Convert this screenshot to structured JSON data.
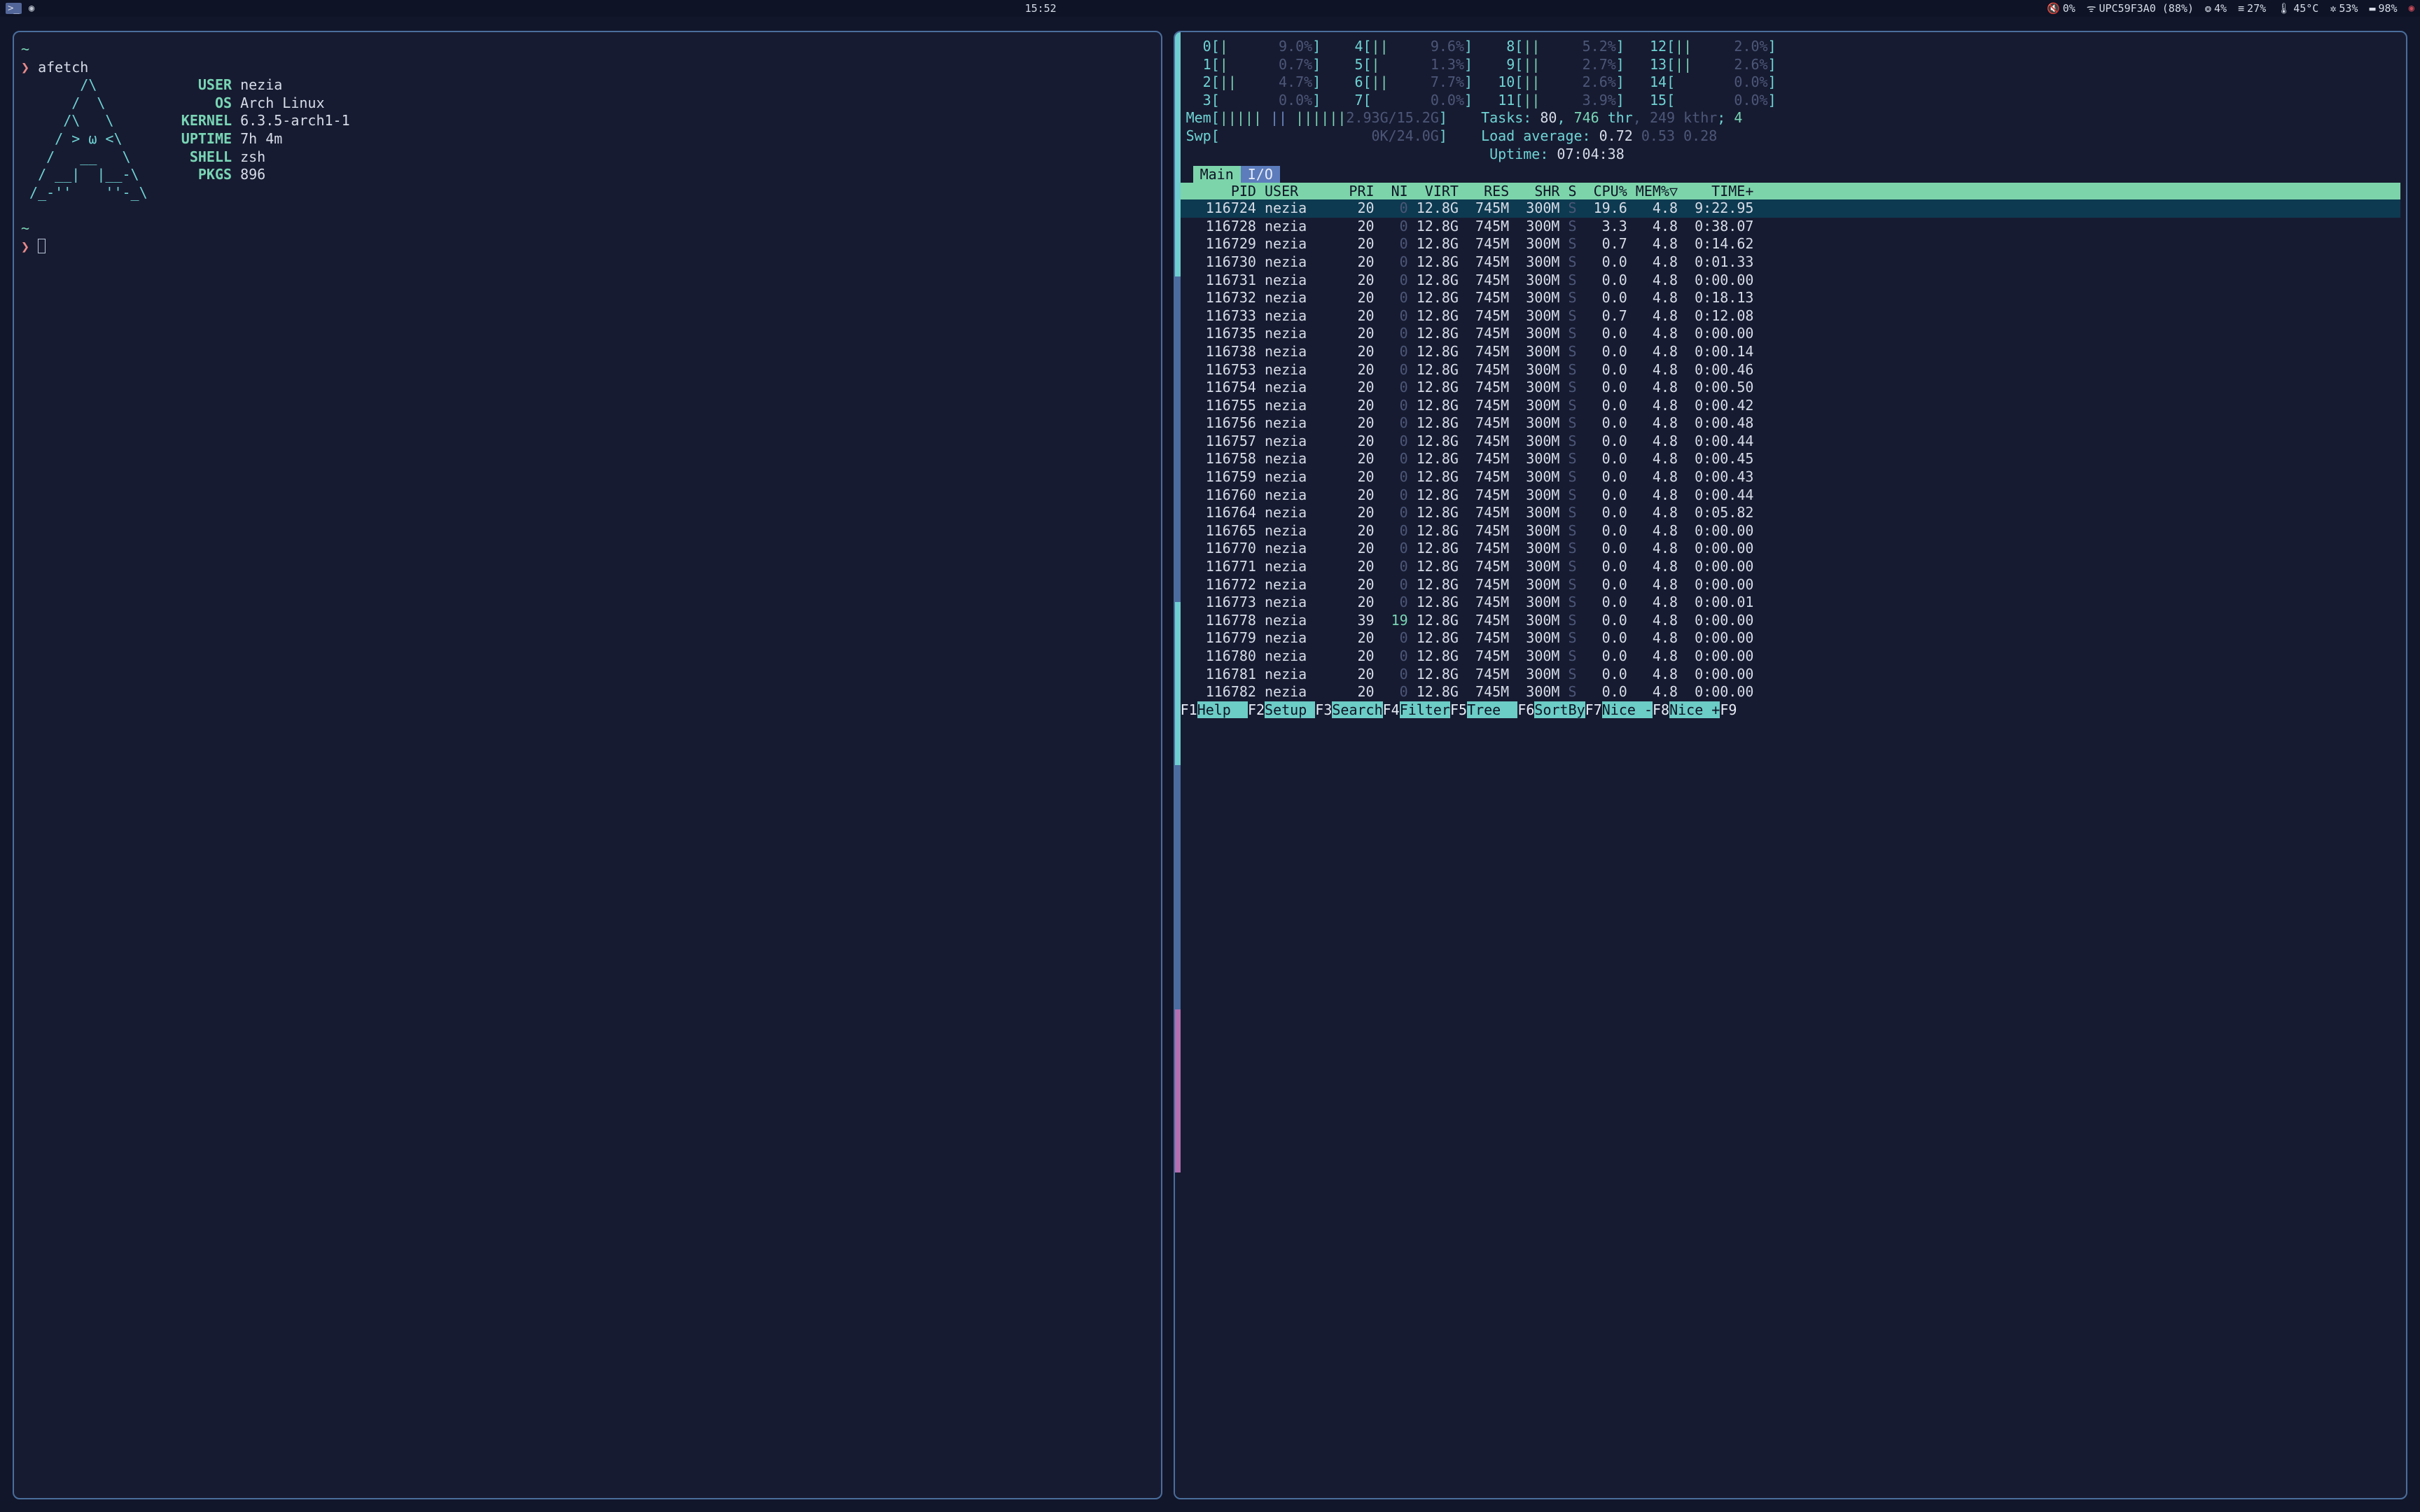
{
  "taskbar": {
    "clock": "15:52",
    "vol_pct": "0%",
    "wifi": "UPC59F3A0 (88%)",
    "gpu_pct": "4%",
    "ram_pct": "27%",
    "temp": "45°C",
    "brightness_pct": "53%",
    "battery_pct": "98%"
  },
  "afetch": {
    "cmd": "afetch",
    "ascii": [
      "       /\\",
      "      /  \\",
      "     /\\   \\",
      "    / > ω <\\",
      "   /   __   \\",
      "  / __|  |__-\\",
      " /_-''    ''-_\\"
    ],
    "rows": [
      {
        "k": "USER",
        "v": "nezia"
      },
      {
        "k": "OS",
        "v": "Arch Linux"
      },
      {
        "k": "KERNEL",
        "v": "6.3.5-arch1-1"
      },
      {
        "k": "UPTIME",
        "v": "7h 4m"
      },
      {
        "k": "SHELL",
        "v": "zsh"
      },
      {
        "k": "PKGS",
        "v": "896"
      }
    ]
  },
  "htop": {
    "cpu": [
      {
        "n": "0",
        "bar": "|",
        "pct": "9.0%"
      },
      {
        "n": "1",
        "bar": "|",
        "pct": "0.7%"
      },
      {
        "n": "2",
        "bar": "||",
        "pct": "4.7%"
      },
      {
        "n": "3",
        "bar": "",
        "pct": "0.0%"
      },
      {
        "n": "4",
        "bar": "||",
        "pct": "9.6%"
      },
      {
        "n": "5",
        "bar": "|",
        "pct": "1.3%"
      },
      {
        "n": "6",
        "bar": "||",
        "pct": "7.7%"
      },
      {
        "n": "7",
        "bar": "",
        "pct": "0.0%"
      },
      {
        "n": "8",
        "bar": "||",
        "pct": "5.2%"
      },
      {
        "n": "9",
        "bar": "||",
        "pct": "2.7%"
      },
      {
        "n": "10",
        "bar": "||",
        "pct": "2.6%"
      },
      {
        "n": "11",
        "bar": "||",
        "pct": "3.9%"
      },
      {
        "n": "12",
        "bar": "||",
        "pct": "2.0%"
      },
      {
        "n": "13",
        "bar": "||",
        "pct": "2.6%"
      },
      {
        "n": "14",
        "bar": "",
        "pct": "0.0%"
      },
      {
        "n": "15",
        "bar": "",
        "pct": "0.0%"
      }
    ],
    "mem": {
      "used": "2.93G",
      "total": "15.2G"
    },
    "swp": {
      "used": "0K",
      "total": "24.0G"
    },
    "tasks": {
      "count": "80",
      "thr": "746",
      "kthr": "249",
      "running": "4"
    },
    "load": [
      "0.72",
      "0.53",
      "0.28"
    ],
    "uptime": "07:04:38",
    "tabs": {
      "main": "Main",
      "io": "I/O"
    },
    "cols": {
      "pid": "PID",
      "user": "USER",
      "pri": "PRI",
      "ni": "NI",
      "virt": "VIRT",
      "res": "RES",
      "shr": "SHR",
      "s": "S",
      "cpu": "CPU%",
      "mem": "MEM%▽",
      "time": "TIME+"
    },
    "procs": [
      {
        "pid": "116724",
        "user": "nezia",
        "pri": "20",
        "ni": "0",
        "virt": "12.8G",
        "res": "745M",
        "shr": "300M",
        "s": "S",
        "cpu": "19.6",
        "mem": "4.8",
        "time": "9:22.95",
        "sel": true
      },
      {
        "pid": "116728",
        "user": "nezia",
        "pri": "20",
        "ni": "0",
        "virt": "12.8G",
        "res": "745M",
        "shr": "300M",
        "s": "S",
        "cpu": "3.3",
        "mem": "4.8",
        "time": "0:38.07"
      },
      {
        "pid": "116729",
        "user": "nezia",
        "pri": "20",
        "ni": "0",
        "virt": "12.8G",
        "res": "745M",
        "shr": "300M",
        "s": "S",
        "cpu": "0.7",
        "mem": "4.8",
        "time": "0:14.62"
      },
      {
        "pid": "116730",
        "user": "nezia",
        "pri": "20",
        "ni": "0",
        "virt": "12.8G",
        "res": "745M",
        "shr": "300M",
        "s": "S",
        "cpu": "0.0",
        "mem": "4.8",
        "time": "0:01.33"
      },
      {
        "pid": "116731",
        "user": "nezia",
        "pri": "20",
        "ni": "0",
        "virt": "12.8G",
        "res": "745M",
        "shr": "300M",
        "s": "S",
        "cpu": "0.0",
        "mem": "4.8",
        "time": "0:00.00"
      },
      {
        "pid": "116732",
        "user": "nezia",
        "pri": "20",
        "ni": "0",
        "virt": "12.8G",
        "res": "745M",
        "shr": "300M",
        "s": "S",
        "cpu": "0.0",
        "mem": "4.8",
        "time": "0:18.13"
      },
      {
        "pid": "116733",
        "user": "nezia",
        "pri": "20",
        "ni": "0",
        "virt": "12.8G",
        "res": "745M",
        "shr": "300M",
        "s": "S",
        "cpu": "0.7",
        "mem": "4.8",
        "time": "0:12.08"
      },
      {
        "pid": "116735",
        "user": "nezia",
        "pri": "20",
        "ni": "0",
        "virt": "12.8G",
        "res": "745M",
        "shr": "300M",
        "s": "S",
        "cpu": "0.0",
        "mem": "4.8",
        "time": "0:00.00"
      },
      {
        "pid": "116738",
        "user": "nezia",
        "pri": "20",
        "ni": "0",
        "virt": "12.8G",
        "res": "745M",
        "shr": "300M",
        "s": "S",
        "cpu": "0.0",
        "mem": "4.8",
        "time": "0:00.14"
      },
      {
        "pid": "116753",
        "user": "nezia",
        "pri": "20",
        "ni": "0",
        "virt": "12.8G",
        "res": "745M",
        "shr": "300M",
        "s": "S",
        "cpu": "0.0",
        "mem": "4.8",
        "time": "0:00.46"
      },
      {
        "pid": "116754",
        "user": "nezia",
        "pri": "20",
        "ni": "0",
        "virt": "12.8G",
        "res": "745M",
        "shr": "300M",
        "s": "S",
        "cpu": "0.0",
        "mem": "4.8",
        "time": "0:00.50"
      },
      {
        "pid": "116755",
        "user": "nezia",
        "pri": "20",
        "ni": "0",
        "virt": "12.8G",
        "res": "745M",
        "shr": "300M",
        "s": "S",
        "cpu": "0.0",
        "mem": "4.8",
        "time": "0:00.42"
      },
      {
        "pid": "116756",
        "user": "nezia",
        "pri": "20",
        "ni": "0",
        "virt": "12.8G",
        "res": "745M",
        "shr": "300M",
        "s": "S",
        "cpu": "0.0",
        "mem": "4.8",
        "time": "0:00.48"
      },
      {
        "pid": "116757",
        "user": "nezia",
        "pri": "20",
        "ni": "0",
        "virt": "12.8G",
        "res": "745M",
        "shr": "300M",
        "s": "S",
        "cpu": "0.0",
        "mem": "4.8",
        "time": "0:00.44"
      },
      {
        "pid": "116758",
        "user": "nezia",
        "pri": "20",
        "ni": "0",
        "virt": "12.8G",
        "res": "745M",
        "shr": "300M",
        "s": "S",
        "cpu": "0.0",
        "mem": "4.8",
        "time": "0:00.45"
      },
      {
        "pid": "116759",
        "user": "nezia",
        "pri": "20",
        "ni": "0",
        "virt": "12.8G",
        "res": "745M",
        "shr": "300M",
        "s": "S",
        "cpu": "0.0",
        "mem": "4.8",
        "time": "0:00.43"
      },
      {
        "pid": "116760",
        "user": "nezia",
        "pri": "20",
        "ni": "0",
        "virt": "12.8G",
        "res": "745M",
        "shr": "300M",
        "s": "S",
        "cpu": "0.0",
        "mem": "4.8",
        "time": "0:00.44"
      },
      {
        "pid": "116764",
        "user": "nezia",
        "pri": "20",
        "ni": "0",
        "virt": "12.8G",
        "res": "745M",
        "shr": "300M",
        "s": "S",
        "cpu": "0.0",
        "mem": "4.8",
        "time": "0:05.82"
      },
      {
        "pid": "116765",
        "user": "nezia",
        "pri": "20",
        "ni": "0",
        "virt": "12.8G",
        "res": "745M",
        "shr": "300M",
        "s": "S",
        "cpu": "0.0",
        "mem": "4.8",
        "time": "0:00.00"
      },
      {
        "pid": "116770",
        "user": "nezia",
        "pri": "20",
        "ni": "0",
        "virt": "12.8G",
        "res": "745M",
        "shr": "300M",
        "s": "S",
        "cpu": "0.0",
        "mem": "4.8",
        "time": "0:00.00"
      },
      {
        "pid": "116771",
        "user": "nezia",
        "pri": "20",
        "ni": "0",
        "virt": "12.8G",
        "res": "745M",
        "shr": "300M",
        "s": "S",
        "cpu": "0.0",
        "mem": "4.8",
        "time": "0:00.00"
      },
      {
        "pid": "116772",
        "user": "nezia",
        "pri": "20",
        "ni": "0",
        "virt": "12.8G",
        "res": "745M",
        "shr": "300M",
        "s": "S",
        "cpu": "0.0",
        "mem": "4.8",
        "time": "0:00.00"
      },
      {
        "pid": "116773",
        "user": "nezia",
        "pri": "20",
        "ni": "0",
        "virt": "12.8G",
        "res": "745M",
        "shr": "300M",
        "s": "S",
        "cpu": "0.0",
        "mem": "4.8",
        "time": "0:00.01"
      },
      {
        "pid": "116778",
        "user": "nezia",
        "pri": "39",
        "ni": "19",
        "virt": "12.8G",
        "res": "745M",
        "shr": "300M",
        "s": "S",
        "cpu": "0.0",
        "mem": "4.8",
        "time": "0:00.00"
      },
      {
        "pid": "116779",
        "user": "nezia",
        "pri": "20",
        "ni": "0",
        "virt": "12.8G",
        "res": "745M",
        "shr": "300M",
        "s": "S",
        "cpu": "0.0",
        "mem": "4.8",
        "time": "0:00.00"
      },
      {
        "pid": "116780",
        "user": "nezia",
        "pri": "20",
        "ni": "0",
        "virt": "12.8G",
        "res": "745M",
        "shr": "300M",
        "s": "S",
        "cpu": "0.0",
        "mem": "4.8",
        "time": "0:00.00"
      },
      {
        "pid": "116781",
        "user": "nezia",
        "pri": "20",
        "ni": "0",
        "virt": "12.8G",
        "res": "745M",
        "shr": "300M",
        "s": "S",
        "cpu": "0.0",
        "mem": "4.8",
        "time": "0:00.00"
      },
      {
        "pid": "116782",
        "user": "nezia",
        "pri": "20",
        "ni": "0",
        "virt": "12.8G",
        "res": "745M",
        "shr": "300M",
        "s": "S",
        "cpu": "0.0",
        "mem": "4.8",
        "time": "0:00.00"
      }
    ],
    "fkeys": [
      {
        "k": "F1",
        "l": "Help  "
      },
      {
        "k": "F2",
        "l": "Setup "
      },
      {
        "k": "F3",
        "l": "Search"
      },
      {
        "k": "F4",
        "l": "Filter"
      },
      {
        "k": "F5",
        "l": "Tree  "
      },
      {
        "k": "F6",
        "l": "SortBy"
      },
      {
        "k": "F7",
        "l": "Nice -"
      },
      {
        "k": "F8",
        "l": "Nice +"
      },
      {
        "k": "F9",
        "l": ""
      }
    ]
  },
  "scrollbar_colors": [
    "#6fcdd0",
    "#6fcdd0",
    "#6fcdd0",
    "#4a6c9e",
    "#4a6c9e",
    "#4a6c9e",
    "#4a6c9e",
    "#6fcdd0",
    "#6fcdd0",
    "#4a6c9e",
    "#4a6c9e",
    "#4a6c9e",
    "#b36fb1",
    "#b36fb1",
    "#171b31",
    "#171b31",
    "#171b31",
    "#171b31"
  ]
}
